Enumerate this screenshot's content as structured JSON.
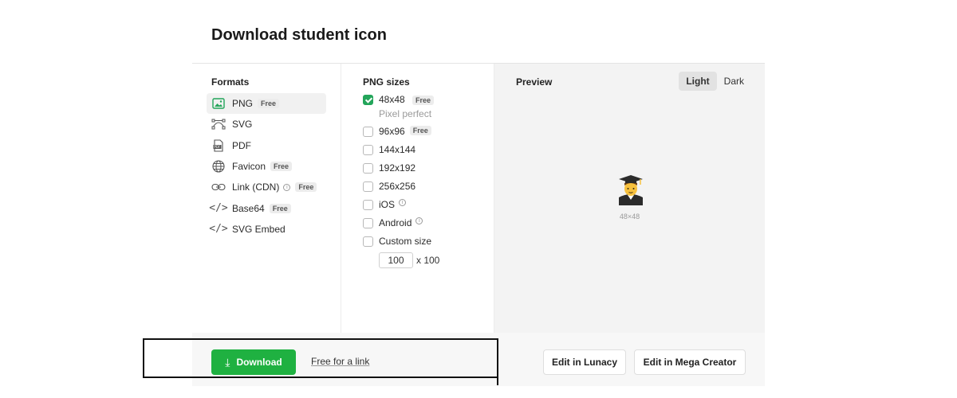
{
  "page": {
    "title": "Download student icon"
  },
  "formats": {
    "heading": "Formats",
    "items": [
      {
        "label": "PNG",
        "badge": "Free",
        "icon": "image-icon",
        "active": true
      },
      {
        "label": "SVG",
        "badge": "",
        "icon": "vector-icon"
      },
      {
        "label": "PDF",
        "badge": "",
        "icon": "pdf-icon"
      },
      {
        "label": "Favicon",
        "badge": "Free",
        "icon": "globe-icon"
      },
      {
        "label": "Link (CDN)",
        "badge": "Free",
        "icon": "link-icon",
        "info": true
      },
      {
        "label": "Base64",
        "badge": "Free",
        "icon": "code-icon"
      },
      {
        "label": "SVG Embed",
        "badge": "",
        "icon": "code-icon"
      }
    ]
  },
  "sizes": {
    "heading": "PNG sizes",
    "items": [
      {
        "label": "48x48",
        "badge": "Free",
        "sub": "Pixel perfect",
        "checked": true
      },
      {
        "label": "96x96",
        "badge": "Free",
        "checked": false
      },
      {
        "label": "144x144",
        "checked": false
      },
      {
        "label": "192x192",
        "checked": false
      },
      {
        "label": "256x256",
        "checked": false
      },
      {
        "label": "iOS",
        "info": true,
        "checked": false
      },
      {
        "label": "Android",
        "info": true,
        "checked": false
      },
      {
        "label": "Custom size",
        "checked": false
      }
    ],
    "custom_width": "100",
    "custom_height_label": "x 100"
  },
  "preview": {
    "heading": "Preview",
    "toggle": {
      "light": "Light",
      "dark": "Dark",
      "selected": "Light"
    },
    "icon": "student-emoji-icon",
    "caption": "48×48"
  },
  "footer": {
    "download_label": "Download",
    "free_link_label": "Free for a link",
    "edit_lunacy_label": "Edit in Lunacy",
    "edit_mega_label": "Edit in Mega Creator"
  },
  "colors": {
    "accent_green": "#1fb141",
    "checkbox_green": "#23a55a",
    "preview_bg": "#f3f3f3"
  }
}
